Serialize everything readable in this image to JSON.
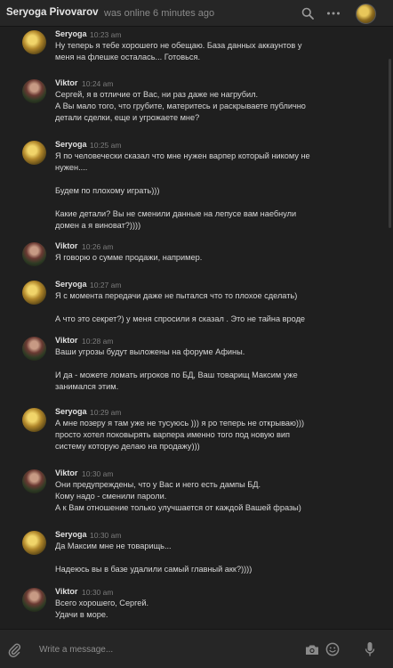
{
  "header": {
    "name": "Seryoga Pivovarov",
    "status": "was online 6 minutes ago",
    "icons": [
      "search-icon",
      "more-icon",
      "avatar"
    ]
  },
  "messages": [
    {
      "author": "Seryoga",
      "time": "10:23 am",
      "avatar": "seryoga",
      "lines": [
        "Ну теперь я тебе хорошего не обещаю. База данных аккаунтов у",
        "меня на флешке осталась... Готовься."
      ]
    },
    {
      "author": "Viktor",
      "time": "10:24 am",
      "avatar": "viktor",
      "lines": [
        "Сергей, я в отличие от Вас, ни раз даже не нагрубил.",
        "А Вы мало того, что грубите, материтесь и раскрываете публично",
        "детали сделки, еще и угрожаете мне?"
      ]
    },
    {
      "author": "Seryoga",
      "time": "10:25 am",
      "avatar": "seryoga",
      "lines": [
        "Я по человечески сказал что мне нужен варпер который никому не",
        "нужен....",
        "",
        "Будем по плохому играть)))",
        "",
        "Какие детали? Вы не сменили данные на лепусе вам наебнули",
        "домен а я виноват?))))"
      ]
    },
    {
      "author": "Viktor",
      "time": "10:26 am",
      "avatar": "viktor",
      "lines": [
        "Я говорю о сумме продажи, например."
      ]
    },
    {
      "author": "Seryoga",
      "time": "10:27 am",
      "avatar": "seryoga",
      "lines": [
        "Я с момента передачи даже не пытался что то плохое сделать)",
        "",
        "А что это секрет?) у меня спросили я сказал . Это не тайна вроде"
      ]
    },
    {
      "author": "Viktor",
      "time": "10:28 am",
      "avatar": "viktor",
      "lines": [
        "Ваши угрозы будут выложены на форуме Афины.",
        "",
        "И да - можете ломать игроков по БД, Ваш товарищ Максим уже",
        "занимался этим."
      ]
    },
    {
      "author": "Seryoga",
      "time": "10:29 am",
      "avatar": "seryoga",
      "lines": [
        "А мне позеру я там уже не тусуюсь ))) я ро теперь не открываю)))",
        "просто хотел поковырять варпера именно того под новую вип",
        "систему которую делаю на продажу)))"
      ]
    },
    {
      "author": "Viktor",
      "time": "10:30 am",
      "avatar": "viktor",
      "lines": [
        "Они предупреждены, что у Вас и него есть дампы БД.",
        "Кому надо - сменили пароли.",
        "А к Вам отношение только улучшается от каждой Вашей фразы)"
      ]
    },
    {
      "author": "Seryoga",
      "time": "10:30 am",
      "avatar": "seryoga",
      "lines": [
        "Да Максим мне не товарищь...",
        "",
        "Надеюсь вы в базе удалили самый главный акк?))))"
      ]
    },
    {
      "author": "Viktor",
      "time": "10:30 am",
      "avatar": "viktor",
      "lines": [
        "Всего хорошего, Сергей.",
        "Удачи в море."
      ]
    }
  ],
  "composer": {
    "placeholder": "Write a message...",
    "icons": [
      "attach-icon",
      "camera-icon",
      "emoji-icon",
      "microphone-icon"
    ]
  }
}
